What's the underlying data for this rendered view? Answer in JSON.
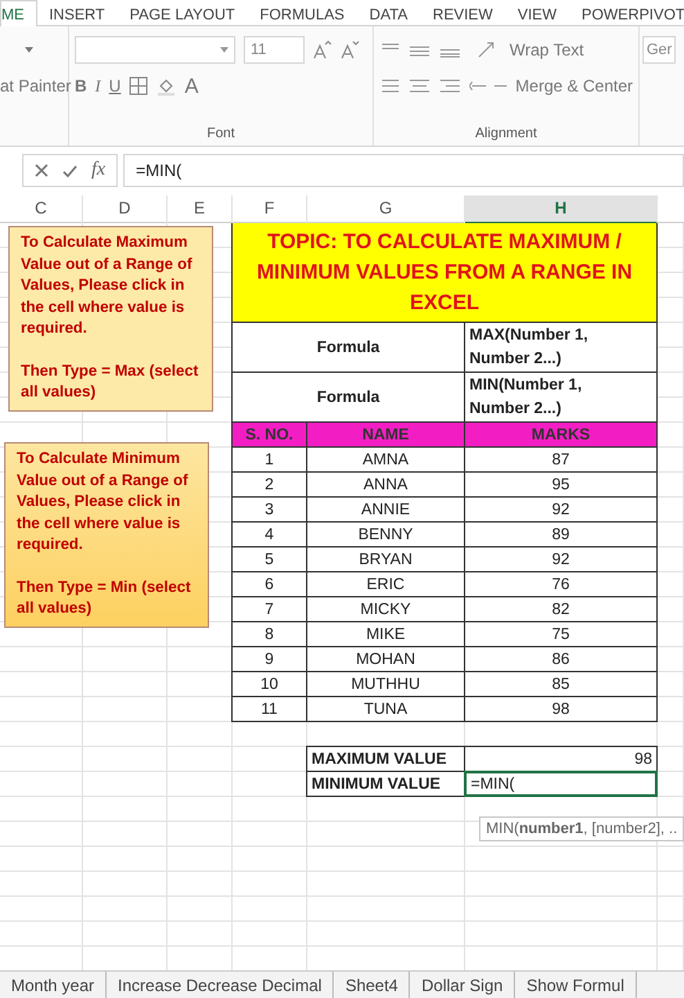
{
  "ribbon": {
    "tabs": [
      {
        "label": "ME",
        "selected": true
      },
      {
        "label": "INSERT",
        "selected": false
      },
      {
        "label": "PAGE LAYOUT",
        "selected": false
      },
      {
        "label": "FORMULAS",
        "selected": false
      },
      {
        "label": "DATA",
        "selected": false
      },
      {
        "label": "REVIEW",
        "selected": false
      },
      {
        "label": "VIEW",
        "selected": false
      },
      {
        "label": "POWERPIVOT",
        "selected": false
      }
    ],
    "clipboard": {
      "format_painter": "at Painter"
    },
    "font": {
      "size": "11",
      "bold": "B",
      "italic": "I",
      "underline": "U",
      "font_color": "A",
      "label": "Font"
    },
    "alignment": {
      "wrap_text": "Wrap Text",
      "merge_center": "Merge & Center",
      "label": "Alignment"
    },
    "number": {
      "format": "Ger"
    }
  },
  "formula_bar": {
    "function_button": "fx",
    "content": "=MIN("
  },
  "columns": [
    {
      "label": "C",
      "selected": false
    },
    {
      "label": "D",
      "selected": false
    },
    {
      "label": "E",
      "selected": false
    },
    {
      "label": "F",
      "selected": false
    },
    {
      "label": "G",
      "selected": false
    },
    {
      "label": "H",
      "selected": true
    }
  ],
  "notes": [
    {
      "paragraphs": [
        "To Calculate Maximum Value out of a Range of Values, Please click in the cell where value is required.",
        "Then Type = Max (select all values)"
      ]
    },
    {
      "paragraphs": [
        "To Calculate Minimum Value out of a Range of Values, Please click in the cell where value is required.",
        "Then Type = Min (select all values)"
      ]
    }
  ],
  "title": "TOPIC: TO CALCULATE MAXIMUM / MINIMUM VALUES FROM A RANGE IN EXCEL",
  "formulas": [
    {
      "label": "Formula",
      "value": "MAX(Number 1, Number 2...)"
    },
    {
      "label": "Formula",
      "value": "MIN(Number 1, Number 2...)"
    }
  ],
  "table": {
    "columns": [
      "S. NO.",
      "NAME",
      "MARKS"
    ],
    "rows": [
      [
        "1",
        "AMNA",
        "87"
      ],
      [
        "2",
        "ANNA",
        "95"
      ],
      [
        "3",
        "ANNIE",
        "92"
      ],
      [
        "4",
        "BENNY",
        "89"
      ],
      [
        "5",
        "BRYAN",
        "92"
      ],
      [
        "6",
        "ERIC",
        "76"
      ],
      [
        "7",
        "MICKY",
        "82"
      ],
      [
        "8",
        "MIKE",
        "75"
      ],
      [
        "9",
        "MOHAN",
        "86"
      ],
      [
        "10",
        "MUTHHU",
        "85"
      ],
      [
        "11",
        "TUNA",
        "98"
      ]
    ]
  },
  "summary": [
    {
      "label": "MAXIMUM VALUE",
      "value": "98",
      "active": false
    },
    {
      "label": "MINIMUM VALUE",
      "value": "=MIN(",
      "active": true
    }
  ],
  "tooltip": "MIN(**number1**, [number2], ..",
  "sheet_tabs": [
    "Month year",
    "Increase Decrease Decimal",
    "Sheet4",
    "Dollar Sign",
    "Show Formul"
  ]
}
